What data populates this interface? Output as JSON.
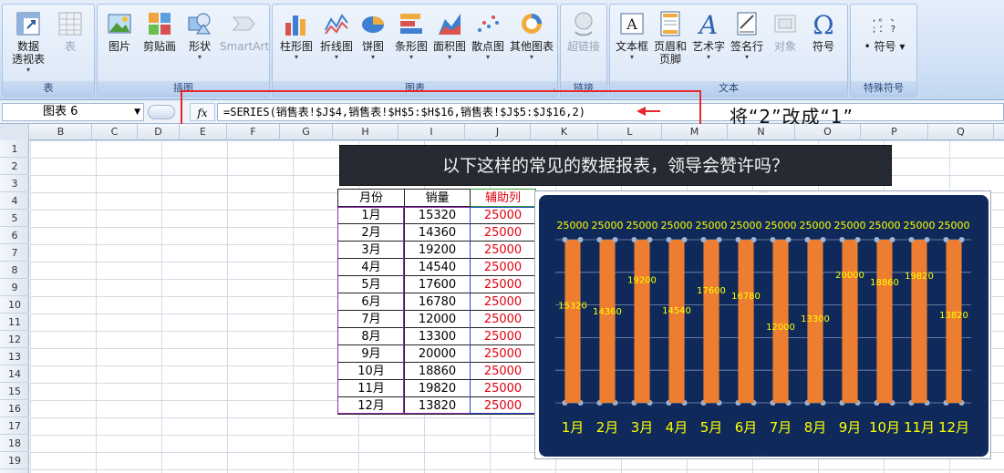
{
  "ribbon": {
    "groups": [
      {
        "label": "表",
        "buttons": [
          {
            "label": "数据\n透视表",
            "icon": "pivot-table-icon",
            "dropdown": true
          },
          {
            "label": "表",
            "icon": "table-icon",
            "disabled": true
          }
        ]
      },
      {
        "label": "插图",
        "buttons": [
          {
            "label": "图片",
            "icon": "picture-icon"
          },
          {
            "label": "剪贴画",
            "icon": "clip-art-icon"
          },
          {
            "label": "形状",
            "icon": "shapes-icon",
            "dropdown": true
          },
          {
            "label": "SmartArt",
            "icon": "smartart-icon",
            "disabled": true
          }
        ]
      },
      {
        "label": "图表",
        "buttons": [
          {
            "label": "柱形图",
            "icon": "column-chart-icon",
            "dropdown": true
          },
          {
            "label": "折线图",
            "icon": "line-chart-icon",
            "dropdown": true
          },
          {
            "label": "饼图",
            "icon": "pie-chart-icon",
            "dropdown": true
          },
          {
            "label": "条形图",
            "icon": "bar-chart-icon",
            "dropdown": true
          },
          {
            "label": "面积图",
            "icon": "area-chart-icon",
            "dropdown": true
          },
          {
            "label": "散点图",
            "icon": "scatter-chart-icon",
            "dropdown": true
          },
          {
            "label": "其他图表",
            "icon": "other-charts-icon",
            "dropdown": true
          }
        ]
      },
      {
        "label": "链接",
        "buttons": [
          {
            "label": "超链接",
            "icon": "hyperlink-icon",
            "disabled": true
          }
        ]
      },
      {
        "label": "文本",
        "buttons": [
          {
            "label": "文本框",
            "icon": "text-box-icon",
            "dropdown": true
          },
          {
            "label": "页眉和\n页脚",
            "icon": "header-footer-icon"
          },
          {
            "label": "艺术字",
            "icon": "wordart-icon",
            "dropdown": true
          },
          {
            "label": "签名行",
            "icon": "signature-line-icon",
            "dropdown": true
          },
          {
            "label": "对象",
            "icon": "object-icon",
            "disabled": true
          },
          {
            "label": "符号",
            "icon": "omega-symbol-icon"
          }
        ]
      },
      {
        "label": "特殊符号",
        "buttons": [
          {
            "label": "符号",
            "icon": "special-symbol-icon",
            "dropdown": true
          }
        ]
      }
    ]
  },
  "formula_bar": {
    "name_box": "图表 6",
    "fx_label": "fx",
    "formula": "=SERIES(销售表!$J$4,销售表!$H$5:$H$16,销售表!$J$5:$J$16,2)"
  },
  "annotation": "将“2”改成“1”",
  "sheet": {
    "columns": [
      "B",
      "C",
      "D",
      "E",
      "F",
      "G",
      "H",
      "I",
      "J",
      "K",
      "L",
      "M",
      "N",
      "O",
      "P",
      "Q"
    ],
    "rows": [
      "1",
      "2",
      "3",
      "4",
      "5",
      "6",
      "7",
      "8",
      "9",
      "10",
      "11",
      "12",
      "13",
      "14",
      "15",
      "16",
      "17",
      "18",
      "19"
    ],
    "banner_title": "以下这样的常见的数据报表，领导会赞许吗？",
    "table": {
      "headers": [
        "月份",
        "销量",
        "辅助列"
      ],
      "rows": [
        [
          "1月",
          "15320",
          "25000"
        ],
        [
          "2月",
          "14360",
          "25000"
        ],
        [
          "3月",
          "19200",
          "25000"
        ],
        [
          "4月",
          "14540",
          "25000"
        ],
        [
          "5月",
          "17600",
          "25000"
        ],
        [
          "6月",
          "16780",
          "25000"
        ],
        [
          "7月",
          "12000",
          "25000"
        ],
        [
          "8月",
          "13300",
          "25000"
        ],
        [
          "9月",
          "20000",
          "25000"
        ],
        [
          "10月",
          "18860",
          "25000"
        ],
        [
          "11月",
          "19820",
          "25000"
        ],
        [
          "12月",
          "13820",
          "25000"
        ]
      ]
    }
  },
  "chart_data": {
    "type": "bar",
    "categories": [
      "1月",
      "2月",
      "3月",
      "4月",
      "5月",
      "6月",
      "7月",
      "8月",
      "9月",
      "10月",
      "11月",
      "12月"
    ],
    "series": [
      {
        "name": "销量",
        "values": [
          15320,
          14360,
          19200,
          14540,
          17600,
          16780,
          12000,
          13300,
          20000,
          18860,
          19820,
          13820
        ],
        "color": "#ed7d31"
      },
      {
        "name": "辅助列",
        "values": [
          25000,
          25000,
          25000,
          25000,
          25000,
          25000,
          25000,
          25000,
          25000,
          25000,
          25000,
          25000
        ],
        "color": "#ed7d31"
      }
    ],
    "ylim": [
      0,
      25000
    ],
    "background": "#0f2a5a",
    "label_color": "#ffff00",
    "grid": true,
    "legend": "none"
  }
}
